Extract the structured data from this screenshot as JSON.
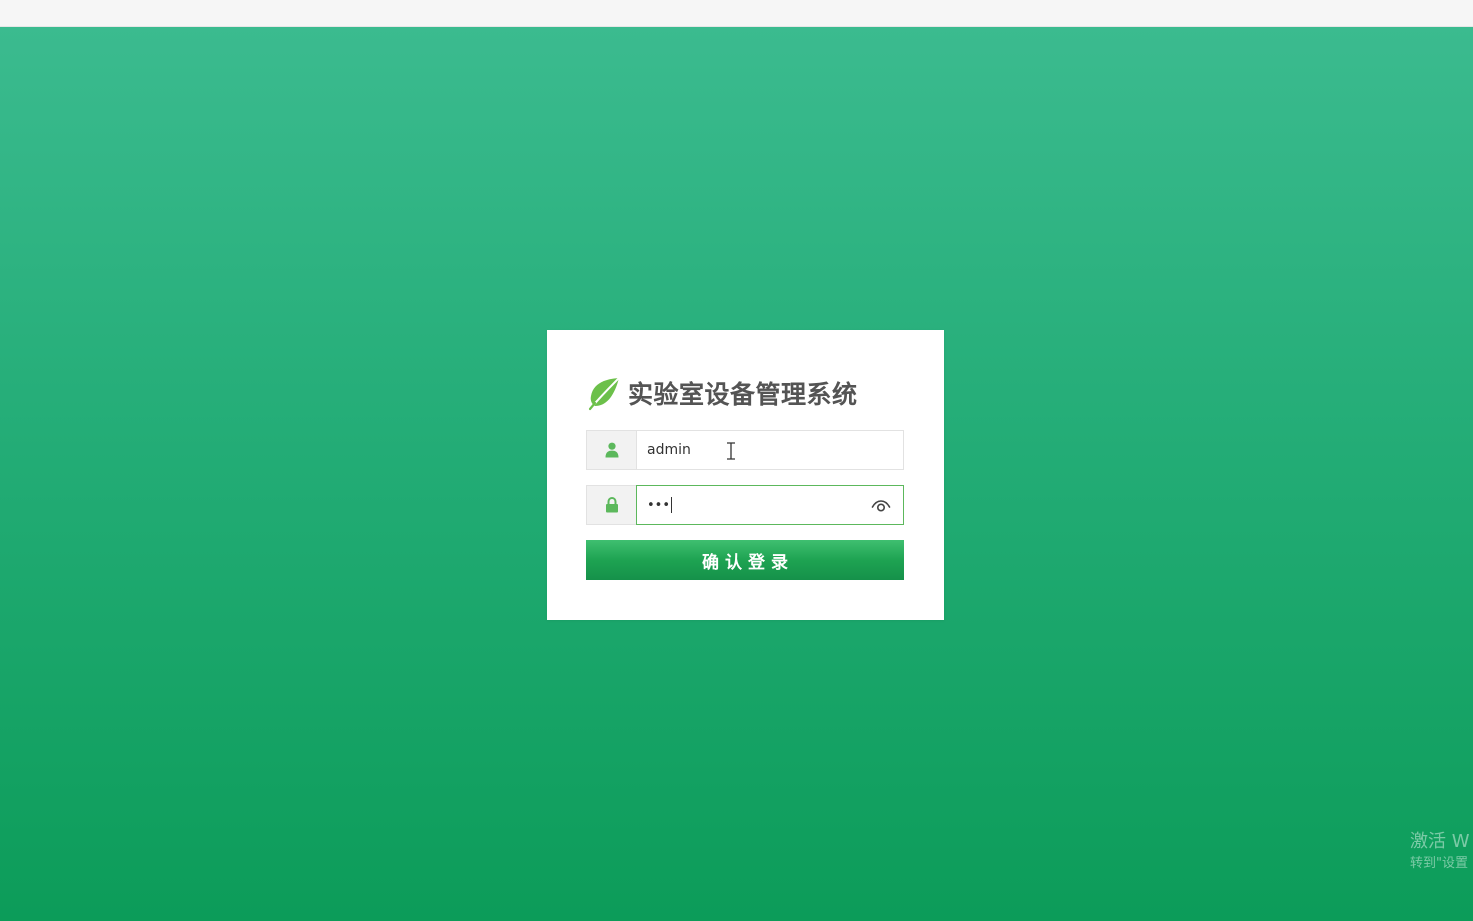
{
  "app": {
    "title": "实验室设备管理系统"
  },
  "login": {
    "username": {
      "value": "admin",
      "icon": "user-icon"
    },
    "password": {
      "masked_value": "•••",
      "icon": "lock-icon",
      "toggle_icon": "eye-icon"
    },
    "submit_label": "确认登录"
  },
  "watermark": {
    "line1": "激活 W",
    "line2": "转到\"设置"
  },
  "colors": {
    "accent": "#1ea352",
    "background_top": "#3bbb8f",
    "background_bottom": "#0c9c59",
    "logo": "#5cb85c"
  }
}
